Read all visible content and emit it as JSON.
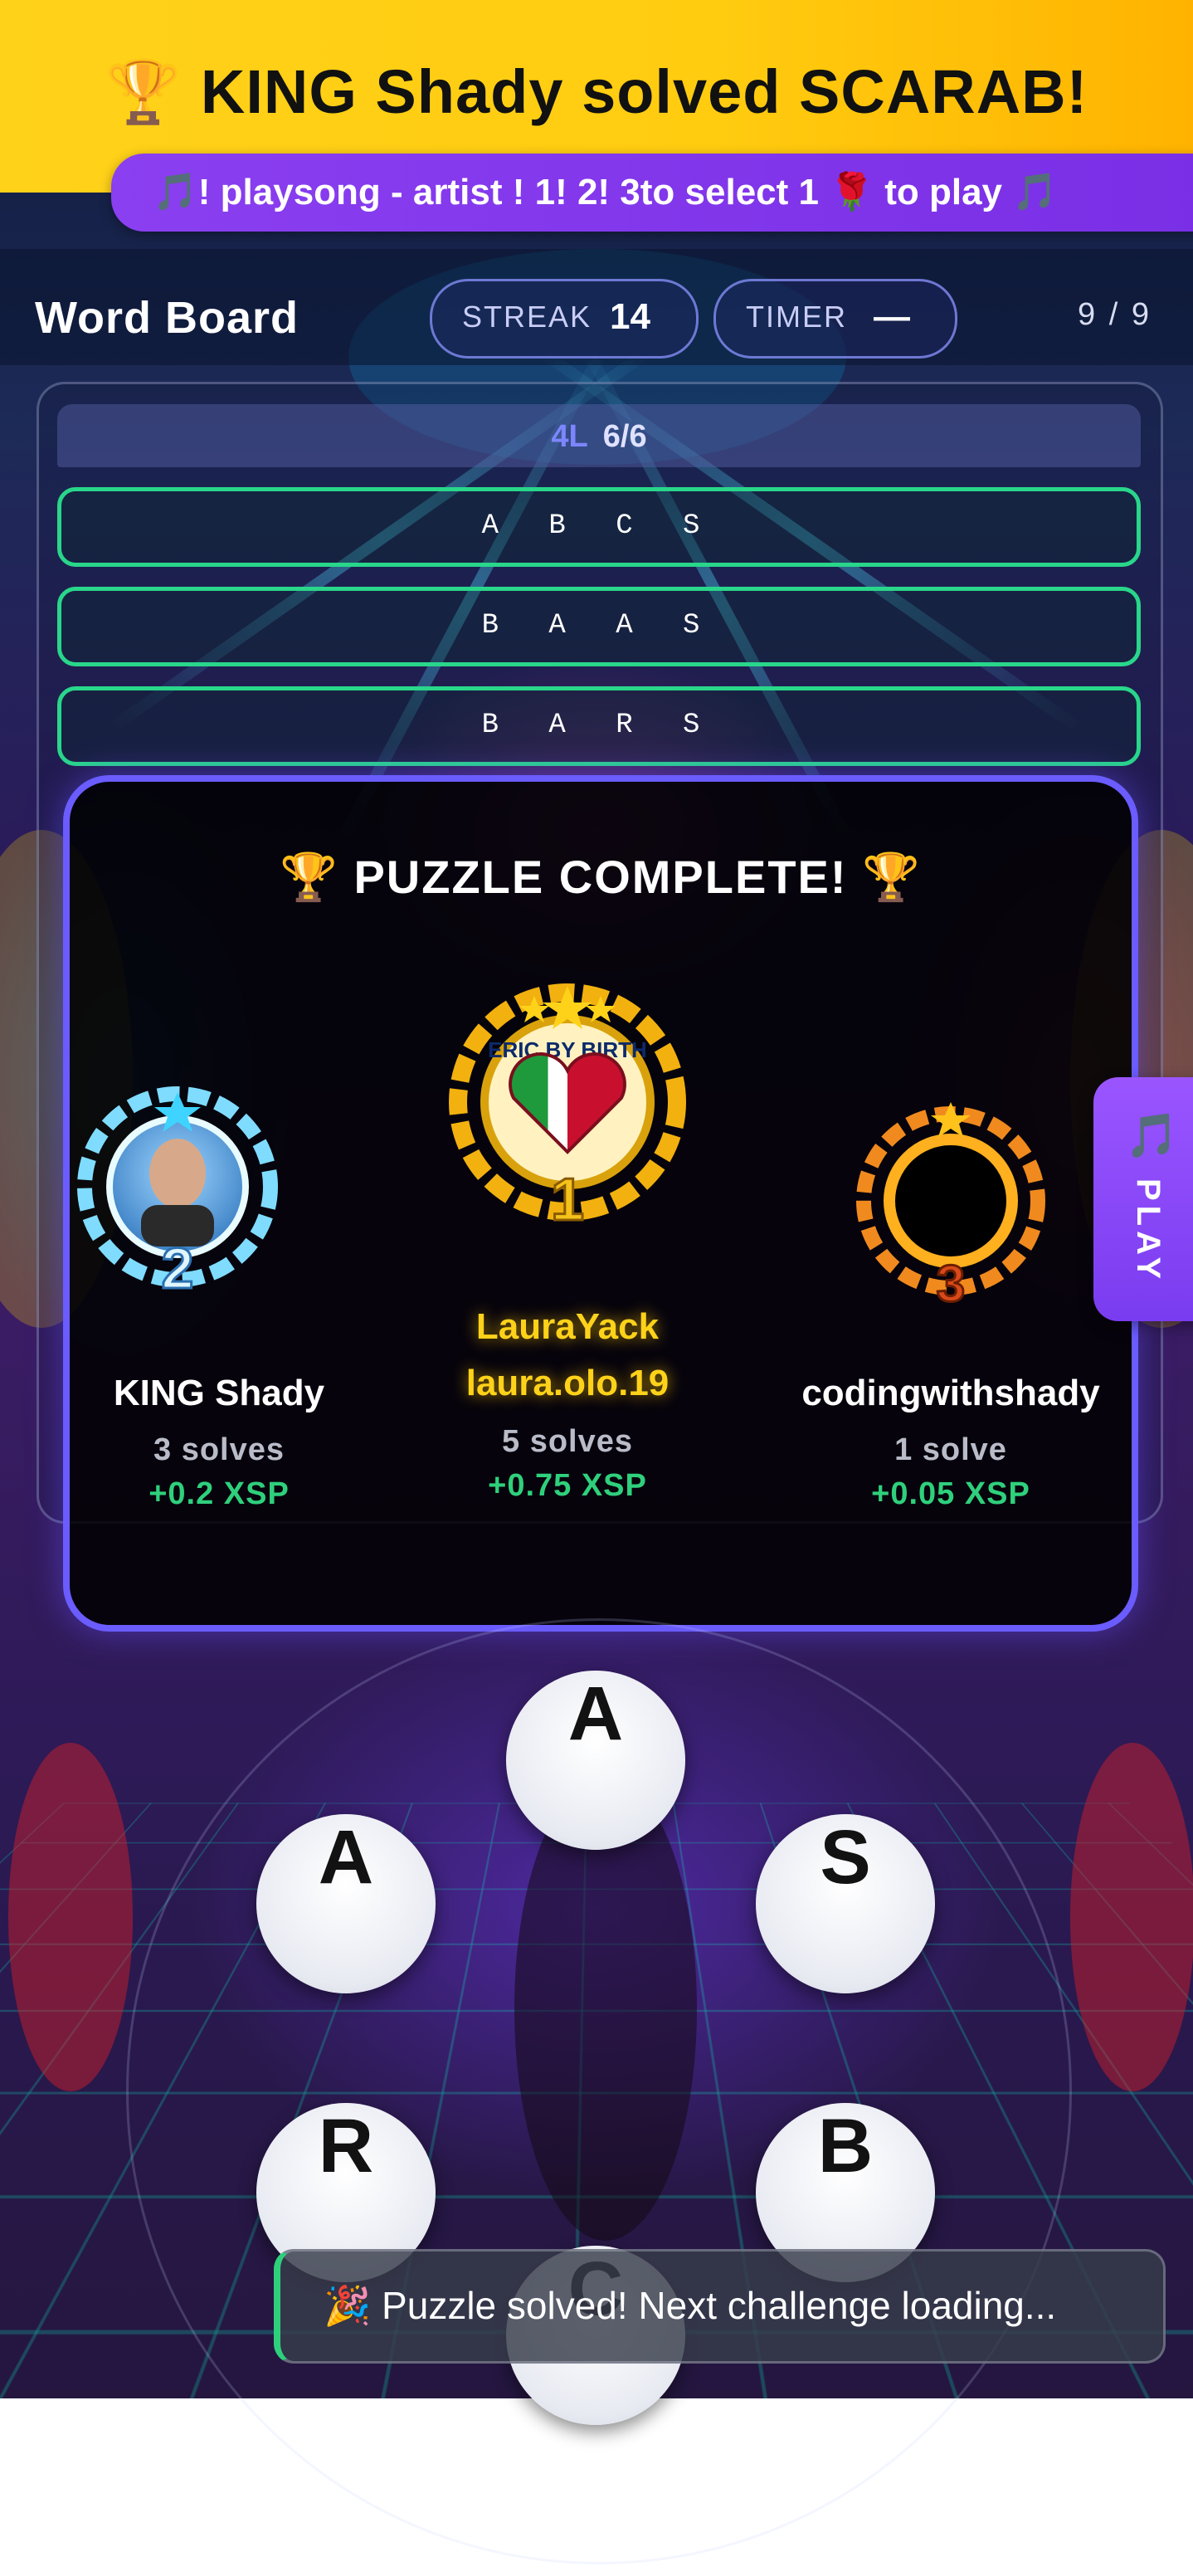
{
  "banner": {
    "trophy": "🏆",
    "title": "KING Shady solved SCARAB!",
    "ticker": "🎵! playsong - artist   ! 1! 2! 3to select   1 🌹 to play   🎵"
  },
  "header": {
    "title": "Word Board",
    "streak_label": "STREAK",
    "streak_value": "14",
    "timer_label": "TIMER",
    "timer_value": "—",
    "progress": "9 / 9"
  },
  "board": {
    "group_length": "4L",
    "group_count": "6/6",
    "words": [
      "A B C S",
      "B A A S",
      "B A R S"
    ]
  },
  "modal": {
    "title": "🏆 PUZZLE COMPLETE! 🏆",
    "first": {
      "rank": "1",
      "badge_text": "ERIC BY BIRTH",
      "name": "LauraYack",
      "handle": "laura.olo.19",
      "solves": "5 solves",
      "reward": "+0.75 XSP"
    },
    "second": {
      "rank": "2",
      "name": "KING Shady",
      "solves": "3 solves",
      "reward": "+0.2 XSP"
    },
    "third": {
      "rank": "3",
      "name": "codingwithshady",
      "solves": "1 solve",
      "reward": "+0.05 XSP"
    }
  },
  "side_tab": {
    "icon": "🎵",
    "label": "PLAY"
  },
  "wheel": {
    "letters": [
      "A",
      "A",
      "S",
      "R",
      "B",
      "C"
    ]
  },
  "toast": {
    "text": "🎉 Puzzle solved! Next challenge loading..."
  },
  "colors": {
    "banner_yellow": "#ffd21a",
    "ticker_purple": "#8a3ff0",
    "word_border_green": "#29d68a",
    "modal_border": "#6a5cff",
    "reward_green": "#2fd07c",
    "gold_text": "#ffd21a"
  }
}
